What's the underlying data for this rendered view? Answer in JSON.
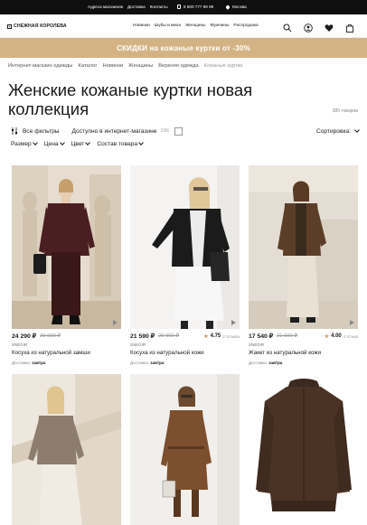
{
  "topbar": {
    "links": [
      "Адреса магазинов",
      "Доставка",
      "Контакты"
    ],
    "phone": "8 800 777 89 99",
    "city": "Москва"
  },
  "header": {
    "logo": "СНЕЖНАЯ КОРОЛЕВА",
    "nav": [
      "Новинки",
      "Шубы и меха",
      "Женщины",
      "Мужчины",
      "Распродажа"
    ],
    "icons": [
      "search-icon",
      "account-icon",
      "heart-icon",
      "bag-icon"
    ]
  },
  "promo": "СКИДКИ на кожаные куртки от -30%",
  "breadcrumbs": [
    "Интернет-магазин одежды",
    "Каталог",
    "Новинки",
    "Женщины",
    "Верхняя одежда",
    "Кожаные куртки"
  ],
  "page": {
    "title": "Женские кожаные куртки новая коллекция",
    "count": "380 товаров"
  },
  "filters": {
    "all_filters": "Все фильтры",
    "available_label": "Доступно в интернет-магазине",
    "available_count": "286",
    "sort_label": "Сортировка:",
    "dropdowns": [
      "Размер",
      "Цена",
      "Цвет",
      "Состав товара"
    ]
  },
  "products": [
    {
      "price": "24 290 ₽",
      "old_price": "29 990 ₽",
      "rating": "",
      "reviews": "",
      "brand": "SNEGIR",
      "name": "Косуха из натуральной замши",
      "delivery_label": "Доставка:",
      "delivery_value": "завтра"
    },
    {
      "price": "21 590 ₽",
      "old_price": "26 990 ₽",
      "rating": "4.75",
      "reviews": "2 отзыва",
      "brand": "SNEGIR",
      "name": "Косуха из натуральной кожи",
      "delivery_label": "Доставка:",
      "delivery_value": "завтра"
    },
    {
      "price": "17 540 ₽",
      "old_price": "21 990 ₽",
      "rating": "4.00",
      "reviews": "1 отзыв",
      "brand": "SNEGIR",
      "name": "Жакет из натуральной кожи",
      "delivery_label": "Доставка:",
      "delivery_value": "завтра"
    }
  ],
  "colors": {
    "promo_bg": "#d3b384",
    "accent_gold": "#c9a36a",
    "topbar_bg": "#0f0f0f"
  }
}
